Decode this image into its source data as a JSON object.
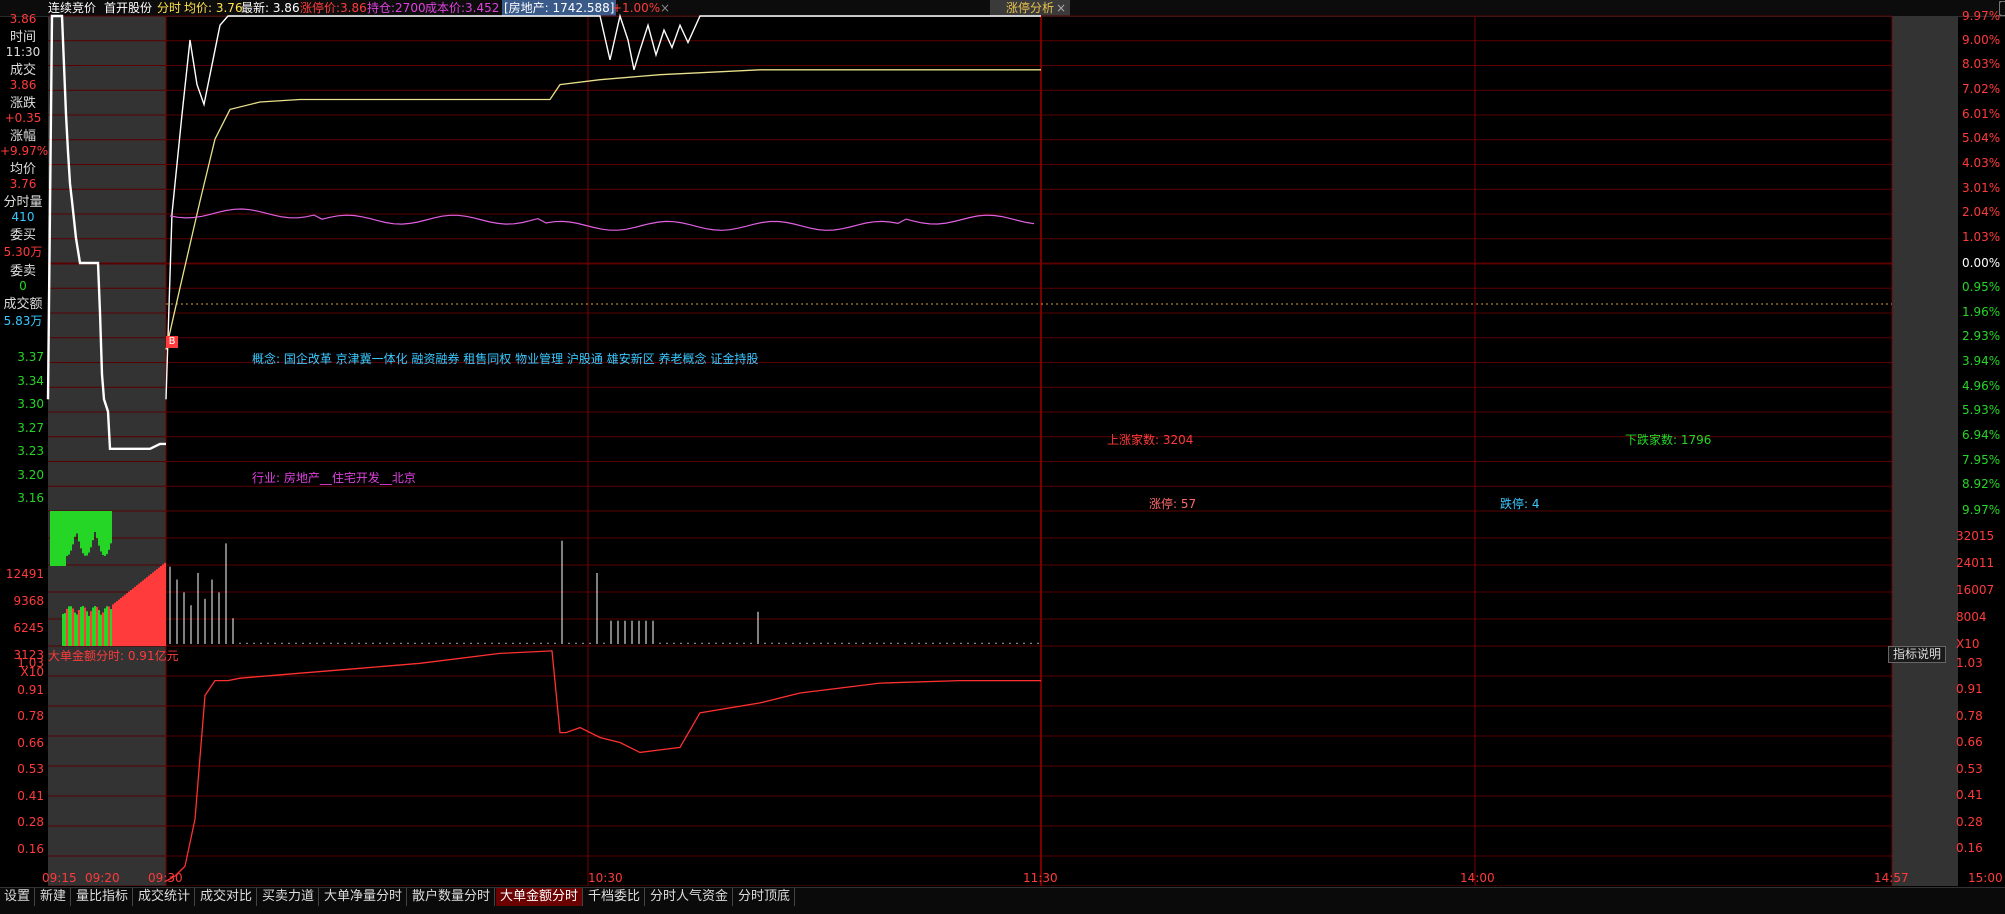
{
  "header": {
    "mode": "连续竞价",
    "stock_name": "首开股份",
    "view": "分时",
    "avg_label": "均价: 3.76",
    "last_label": "最新: 3.86",
    "limit_label": "涨停价:3.86",
    "holding_label": "持仓:2700",
    "cost_label": "成本价:3.452",
    "sector_label": "[房地产: 1742.588]",
    "sector_change": "+1.00%",
    "close_x": "×",
    "tab_label": "涨停分析",
    "tab_close": "×"
  },
  "sidebar": {
    "top_price": "3.86",
    "time_label": "时间",
    "time_value": "11:30",
    "deal_label": "成交",
    "deal_value": "3.86",
    "change_label": "涨跌",
    "change_value": "+0.35",
    "pct_label": "涨幅",
    "pct_value": "+9.97%",
    "avg_label": "均价",
    "avg_value": "3.76",
    "vol_label": "分时量",
    "vol_value": "410",
    "bid_label": "委买",
    "bid_value": "5.30万",
    "ask_label": "委卖",
    "ask_value": "0",
    "amount_label": "成交额",
    "amount_value": "5.83万"
  },
  "price_axis_left": [
    "3.37",
    "3.34",
    "3.30",
    "3.27",
    "3.23",
    "3.20",
    "3.16"
  ],
  "price_axis_right": [
    "9.97%",
    "9.00%",
    "8.03%",
    "7.02%",
    "6.01%",
    "5.04%",
    "4.03%",
    "3.01%",
    "2.04%",
    "1.03%",
    "0.00%",
    "0.95%",
    "1.96%",
    "2.93%",
    "3.94%",
    "4.96%",
    "5.93%",
    "6.94%",
    "7.95%",
    "8.92%",
    "9.97%"
  ],
  "price_axis_right_values": [
    9.97,
    9.0,
    8.03,
    7.02,
    6.01,
    5.04,
    4.03,
    3.01,
    2.04,
    1.03,
    0.0,
    -0.95,
    -1.96,
    -2.93,
    -3.94,
    -4.96,
    -5.93,
    -6.94,
    -7.95,
    -8.92,
    -9.97
  ],
  "volume_axis_left": [
    "12491",
    "9368",
    "6245",
    "3123",
    "X10"
  ],
  "volume_axis_right": [
    "32015",
    "24011",
    "16007",
    "8004",
    "X10"
  ],
  "big_order": {
    "title": "大单金额分时: 0.91亿元",
    "explain_button": "指标说明",
    "axis": [
      "1.03",
      "0.91",
      "0.78",
      "0.66",
      "0.53",
      "0.41",
      "0.28",
      "0.16"
    ]
  },
  "time_axis": [
    "09:15",
    "09:20",
    "09:30",
    "10:30",
    "11:30",
    "14:00",
    "14:57",
    "15:00"
  ],
  "info": {
    "concept": "概念: 国企改革  京津冀一体化  融资融券  租售同权  物业管理  沪股通  雄安新区  养老概念  证金持股",
    "industry": "行业: 房地产__住宅开发__北京",
    "up_count": "上涨家数: 3204",
    "down_count": "下跌家数: 1796",
    "limit_up": "涨停: 57",
    "limit_down": "跌停: 4",
    "buy_marker": "B"
  },
  "bottom_tabs": [
    "设置",
    "新建",
    "量比指标",
    "成交统计",
    "成交对比",
    "买卖力道",
    "大单净量分时",
    "散户数量分时",
    "大单金额分时",
    "千档委比",
    "分时人气资金",
    "分时顶底"
  ],
  "active_tab": "大单金额分时",
  "colors": {
    "up": "#ff3b3b",
    "down": "#26d626",
    "grid": "#5a0000",
    "price_line": "#ffffff",
    "avg_line": "#e8e08a",
    "sector_line": "#e060e0",
    "big_order_line": "#ff3030",
    "text_cyan": "#39c8ff",
    "text_magenta": "#e040e0"
  }
}
